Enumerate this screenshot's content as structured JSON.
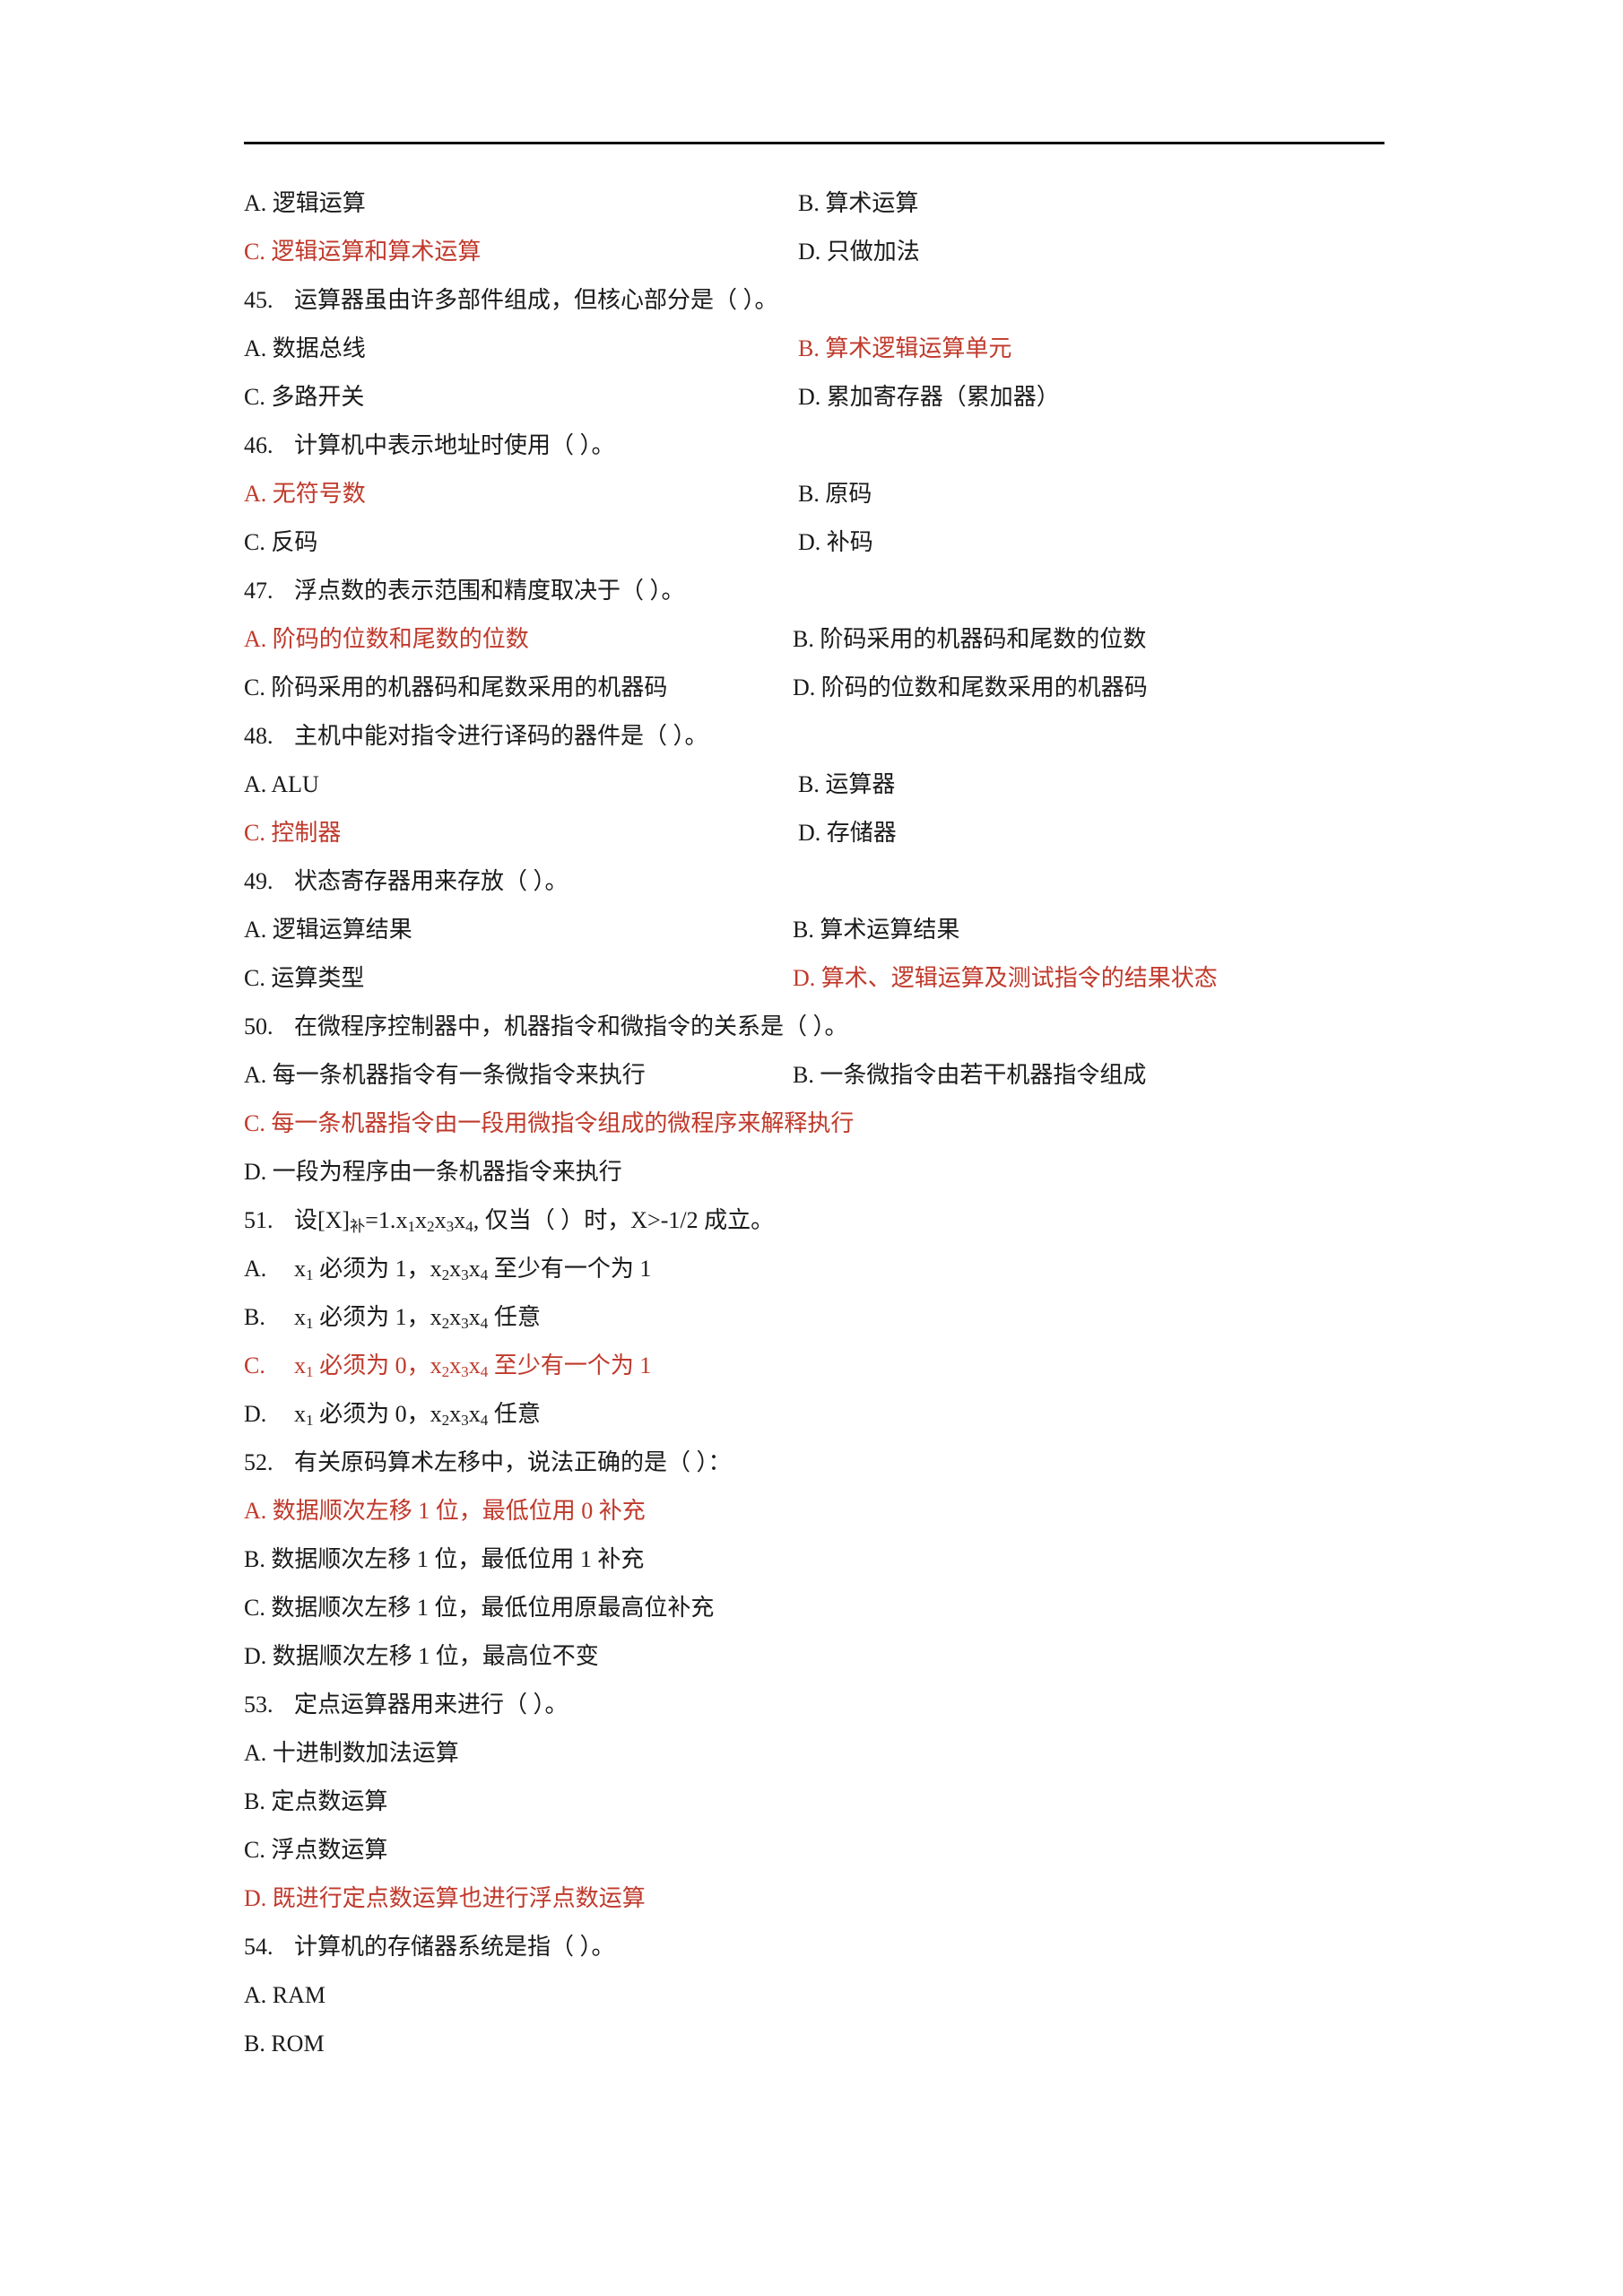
{
  "document": {
    "type": "exam-worksheet",
    "language": "zh-CN",
    "accent_color": "#C0392B",
    "text_color": "#1a1a1a",
    "has_header_rule": true
  },
  "q44_tail": {
    "optA": "A.  逻辑运算",
    "optB": "B. 算术运算",
    "optC": "C.  逻辑运算和算术运算",
    "optD": "D. 只做加法"
  },
  "q45": {
    "number": "45.",
    "stem": "运算器虽由许多部件组成，但核心部分是（  ）。",
    "optA": "A.  数据总线",
    "optB": "B. 算术逻辑运算单元",
    "optC": "C.  多路开关",
    "optD": "D. 累加寄存器（累加器）"
  },
  "q46": {
    "number": "46.",
    "stem": "计算机中表示地址时使用（  ）。",
    "optA": "A.  无符号数",
    "optB": "B. 原码",
    "optC": "C.  反码",
    "optD": "D. 补码"
  },
  "q47": {
    "number": "47.",
    "stem": "浮点数的表示范围和精度取决于（  ）。",
    "optA": "A.  阶码的位数和尾数的位数",
    "optB": "B.  阶码采用的机器码和尾数的位数",
    "optC": "C.  阶码采用的机器码和尾数采用的机器码",
    "optD": "D. 阶码的位数和尾数采用的机器码"
  },
  "q48": {
    "number": "48.",
    "stem": "主机中能对指令进行译码的器件是（  ）。",
    "optA": "A.  ALU",
    "optB": "B. 运算器",
    "optC": "C. 控制器",
    "optD": "D. 存储器"
  },
  "q49": {
    "number": "49.",
    "stem": "状态寄存器用来存放（  ）。",
    "optA": "A.  逻辑运算结果",
    "optB": "B. 算术运算结果",
    "optC": "C.  运算类型",
    "optD": "D. 算术、逻辑运算及测试指令的结果状态"
  },
  "q50": {
    "number": "50.",
    "stem": "在微程序控制器中，机器指令和微指令的关系是（  ）。",
    "optA": "A.  每一条机器指令有一条微指令来执行",
    "optB": "B. 一条微指令由若干机器指令组成",
    "optC": "C.  每一条机器指令由一段用微指令组成的微程序来解释执行",
    "optD": "D. 一段为程序由一条机器指令来执行"
  },
  "q51": {
    "number": "51.",
    "stem_parts": {
      "p1": "设[X]",
      "sub1": "补",
      "p2": "=1.",
      "x1": "x",
      "x1s": "1",
      "x2": "x",
      "x2s": "2",
      "x3": "x",
      "x3s": "3",
      "x4": "x",
      "x4s": "4",
      "p3": ", 仅当（  ）时，X>-1/2 成立。"
    },
    "stem_plain": "设[X]补=1.x1x2x3x4, 仅当（  ）时，X>-1/2 成立。",
    "optA": {
      "letter": "A.",
      "t1": "x",
      "s1": "1",
      "t2": " 必须为 1，",
      "t3": "x",
      "s2": "2",
      "t4": "x",
      "s3": "3",
      "t5": "x",
      "s4": "4",
      "t6": " 至少有一个为 1"
    },
    "optB": {
      "letter": "B.",
      "t1": "x",
      "s1": "1",
      "t2": " 必须为 1，",
      "t3": "x",
      "s2": "2",
      "t4": "x",
      "s3": "3",
      "t5": "x",
      "s4": "4",
      "t6": " 任意"
    },
    "optC": {
      "letter": "C.",
      "t1": "x",
      "s1": "1",
      "t2": " 必须为 0，",
      "t3": "x",
      "s2": "2",
      "t4": "x",
      "s3": "3",
      "t5": "x",
      "s4": "4",
      "t6": " 至少有一个为 1"
    },
    "optD": {
      "letter": "D.",
      "t1": "x",
      "s1": "1",
      "t2": " 必须为 0，",
      "t3": "x",
      "s2": "2",
      "t4": "x",
      "s3": "3",
      "t5": "x",
      "s4": "4",
      "t6": " 任意"
    }
  },
  "q52": {
    "number": "52.",
    "stem": "有关原码算术左移中，说法正确的是（  ）：",
    "optA": "A.     数据顺次左移 1 位，最低位用 0 补充",
    "optB": "B.     数据顺次左移 1 位，最低位用 1 补充",
    "optC": "C.     数据顺次左移 1 位，最低位用原最高位补充",
    "optD": "D.     数据顺次左移 1 位，最高位不变"
  },
  "q53": {
    "number": "53.",
    "stem": "定点运算器用来进行（  ）。",
    "optA": "A.     十进制数加法运算",
    "optB": "B.     定点数运算",
    "optC": "C.     浮点数运算",
    "optD": "D.     既进行定点数运算也进行浮点数运算"
  },
  "q54": {
    "number": "54.",
    "stem": "计算机的存储器系统是指（  ）。",
    "optA": "A.     RAM",
    "optB": "B.     ROM"
  }
}
